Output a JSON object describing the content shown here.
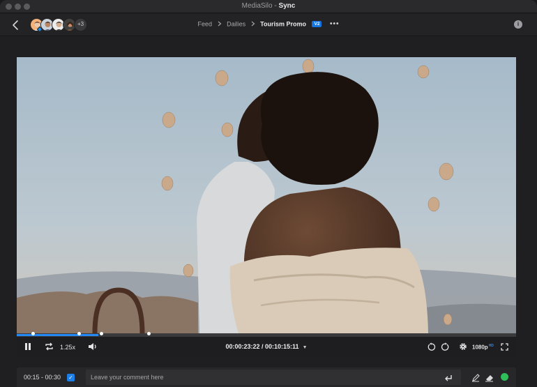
{
  "window": {
    "app_name": "MediaSilo",
    "separator": " - ",
    "mode": "Sync"
  },
  "nav": {
    "extra_viewers": "+3",
    "breadcrumb": [
      "Feed",
      "Dailies"
    ],
    "current_asset": "Tourism Promo",
    "version": "V2",
    "more_icon": "ellipsis-icon",
    "info_icon": "info-icon",
    "info_glyph": "i"
  },
  "player": {
    "playback_progress": 0.163,
    "range_markers": [
      0.033,
      0.125,
      0.169,
      0.265
    ],
    "speed": "1.25x",
    "timecode": "00:00:23:22 / 00:10:15:11",
    "quality": "1080p",
    "quality_badge": "HD"
  },
  "comment": {
    "range": "00:15 - 00:30",
    "range_enabled": true,
    "placeholder": "Leave your comment here"
  },
  "colors": {
    "accent": "#1e88e5",
    "status": "#2fbf5a"
  }
}
